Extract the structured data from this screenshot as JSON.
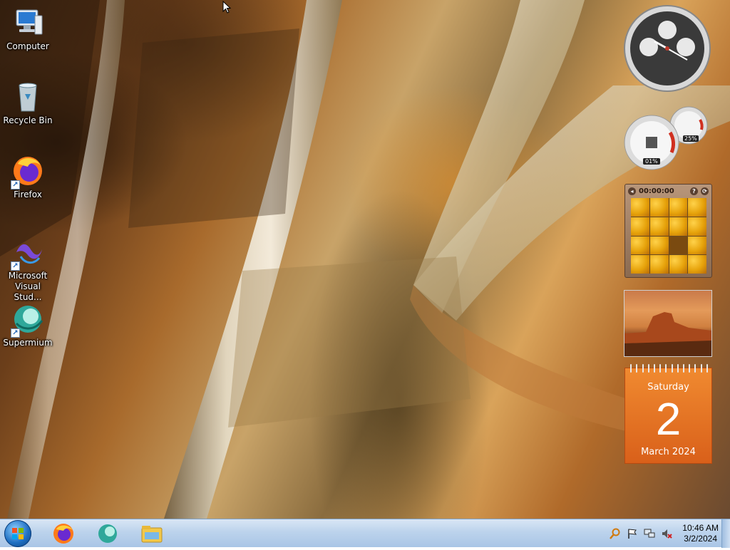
{
  "desktop": {
    "icons": [
      {
        "label": "Computer",
        "icon": "computer-icon"
      },
      {
        "label": "Recycle Bin",
        "icon": "recycle-bin-icon"
      },
      {
        "label": "Firefox",
        "icon": "firefox-icon"
      },
      {
        "label": "Microsoft Visual Stud...",
        "icon": "visual-studio-icon"
      },
      {
        "label": "Supermium",
        "icon": "supermium-icon"
      }
    ]
  },
  "gadgets": {
    "cpu_meter": {
      "cpu_percent": "01%",
      "memory_percent": "25%"
    },
    "puzzle": {
      "timer": "00:00:00",
      "help_symbol": "?",
      "shuffle_symbol": "⟳"
    },
    "calendar": {
      "day_name": "Saturday",
      "date": "2",
      "month_year": "March 2024"
    }
  },
  "taskbar": {
    "pinned": [
      {
        "icon": "firefox-icon"
      },
      {
        "icon": "supermium-icon"
      },
      {
        "icon": "file-explorer-icon"
      }
    ],
    "tray": {
      "icons": [
        "search-icon",
        "flag-icon",
        "network-icon",
        "volume-muted-icon"
      ],
      "time": "10:46 AM",
      "date": "3/2/2024"
    }
  },
  "colors": {
    "taskbar": "#bcd3ec",
    "calendar_accent": "#e8721f",
    "start_orb": "#1f6fc2"
  }
}
